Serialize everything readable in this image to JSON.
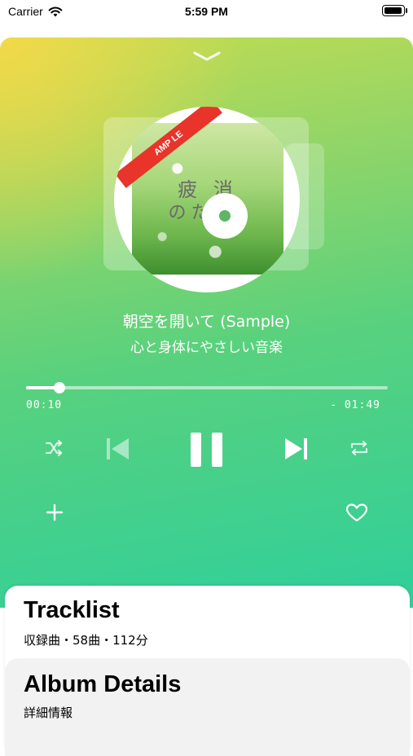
{
  "status_bar": {
    "carrier": "Carrier",
    "time": "5:59 PM"
  },
  "player": {
    "gradient_colors": [
      "#f2d949",
      "#93d567",
      "#2fcf9b"
    ],
    "artwork": {
      "ribbon_text": "AMP LE",
      "cover_line1": "疲 消",
      "cover_line2": "のた 楽",
      "hole_color": "#5fb564"
    },
    "track_title": "朝空を開いて (Sample)",
    "album_title": "心と身体にやさしい音楽",
    "progress": {
      "fraction": 0.093,
      "elapsed": "00:10",
      "remaining": "- 01:49"
    },
    "controls": [
      "shuffle-icon",
      "previous-icon",
      "pause-icon",
      "next-icon",
      "repeat-icon"
    ],
    "actions": [
      "add-icon",
      "heart-icon"
    ]
  },
  "tracklist": {
    "title": "Tracklist",
    "subtitle": "収録曲・58曲・112分"
  },
  "album_details": {
    "title": "Album Details",
    "subtitle": "詳細情報"
  }
}
